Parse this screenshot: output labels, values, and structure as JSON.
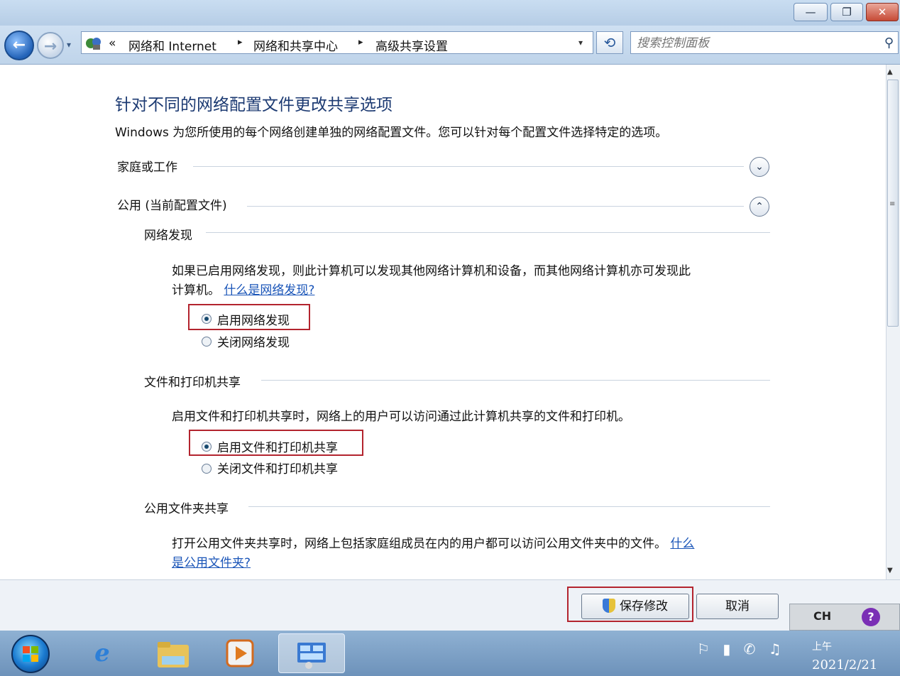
{
  "window": {
    "min_glyph": "—",
    "max_glyph": "❐",
    "close_glyph": "✕"
  },
  "nav": {
    "back_glyph": "←",
    "forward_glyph": "→",
    "dropdown_glyph": "▾",
    "breadcrumb": {
      "overflow": "«",
      "items": [
        "网络和 Internet",
        "网络和共享中心",
        "高级共享设置"
      ],
      "separator": "▸",
      "dropdown_glyph": "▾"
    },
    "refresh_glyph": "⟲",
    "search_placeholder": "搜索控制面板",
    "search_icon": "⚲"
  },
  "page": {
    "title": "针对不同的网络配置文件更改共享选项",
    "description": "Windows 为您所使用的每个网络创建单独的网络配置文件。您可以针对每个配置文件选择特定的选项。"
  },
  "profiles": [
    {
      "label": "家庭或工作",
      "state": "collapsed",
      "toggle_glyph": "⌄"
    },
    {
      "label": "公用 (当前配置文件)",
      "state": "expanded",
      "toggle_glyph": "⌃"
    }
  ],
  "sections": {
    "discovery": {
      "title": "网络发现",
      "text_line1": "如果已启用网络发现，则此计算机可以发现其他网络计算机和设备，而其他网络计算机亦可发现此",
      "text_line2": "计算机。",
      "link": "什么是网络发现?",
      "option_on": "启用网络发现",
      "option_off": "关闭网络发现",
      "selected": "on"
    },
    "file_print": {
      "title": "文件和打印机共享",
      "text": "启用文件和打印机共享时，网络上的用户可以访问通过此计算机共享的文件和打印机。",
      "option_on": "启用文件和打印机共享",
      "option_off": "关闭文件和打印机共享",
      "selected": "on"
    },
    "public_folder": {
      "title": "公用文件夹共享",
      "text": "打开公用文件夹共享时，网络上包括家庭组成员在内的用户都可以访问公用文件夹中的文件。",
      "link_part1": "什么",
      "link_part2": "是公用文件夹?"
    }
  },
  "actions": {
    "save_label": "保存修改",
    "cancel_label": "取消"
  },
  "ime": {
    "text": "CH",
    "help": "?"
  },
  "taskbar": {
    "apps": [
      "internet-explorer",
      "windows-explorer",
      "media-player",
      "network-center"
    ],
    "tray": "⚐ ▮ ✆ ♫",
    "time": "上午",
    "date": "2021/2/21"
  },
  "colors": {
    "title": "#1c3a72",
    "link": "#1a55b8",
    "highlight_box": "#b3242e",
    "taskbar": "#6d92ba"
  }
}
